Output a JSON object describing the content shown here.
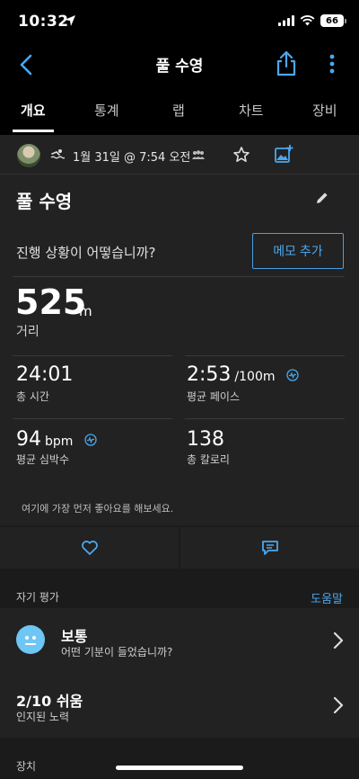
{
  "status_bar": {
    "time": "10:32",
    "battery": "66"
  },
  "nav": {
    "title": "풀 수영"
  },
  "tabs": [
    {
      "label": "개요"
    },
    {
      "label": "통계"
    },
    {
      "label": "랩"
    },
    {
      "label": "차트"
    },
    {
      "label": "장비"
    }
  ],
  "activity": {
    "date_text": "1월 31일 @ 7:54 오전",
    "title": "풀 수영",
    "progress_question": "진행 상황이 어떻습니까?",
    "memo_button": "메모 추가"
  },
  "distance": {
    "value": "525",
    "unit": "m",
    "label": "거리"
  },
  "stats": {
    "total_time": {
      "value": "24:01",
      "label": "총 시간"
    },
    "avg_pace": {
      "value": "2:53",
      "unit": "/100m",
      "label": "평균 페이스"
    },
    "avg_hr": {
      "value": "94",
      "unit": "bpm",
      "label": "평균 심박수"
    },
    "calories": {
      "value": "138",
      "label": "총 칼로리"
    }
  },
  "like_hint": "여기에 가장 먼저 좋아요를 해보세요.",
  "self_eval": {
    "header": "자기 평가",
    "help": "도움말",
    "feel": {
      "title": "보통",
      "subtitle": "어떤 기분이 들었습니까?"
    },
    "effort": {
      "title": "2/10 쉬움",
      "subtitle": "인지된 노력"
    }
  },
  "device_header": "장치",
  "colors": {
    "accent": "#4aa8f0",
    "background": "#000000",
    "card": "#222222",
    "face": "#6ec6f5"
  }
}
